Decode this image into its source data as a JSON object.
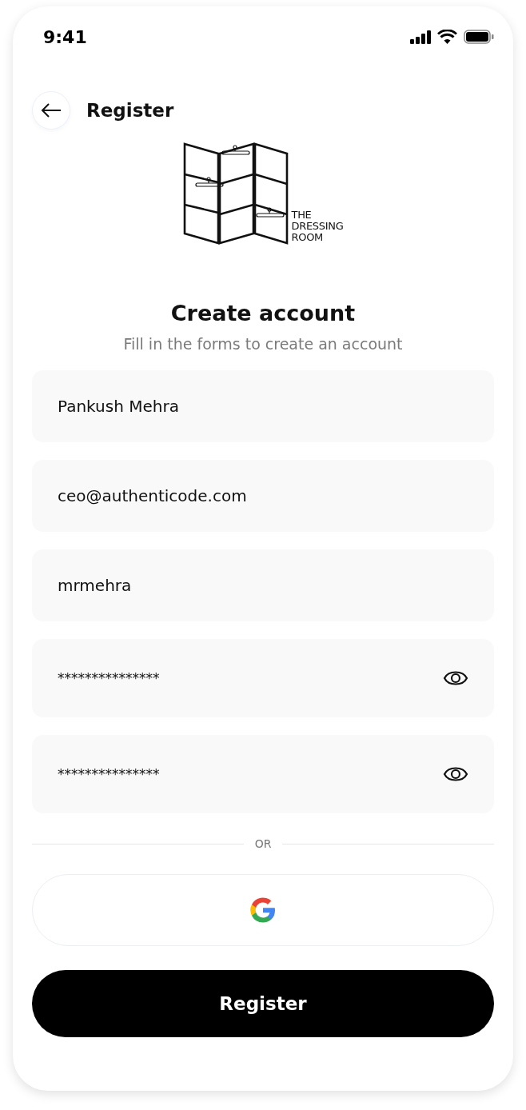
{
  "status_bar": {
    "time": "9:41"
  },
  "header": {
    "title": "Register"
  },
  "logo": {
    "lines": [
      "THE",
      "DRESSING",
      "ROOM"
    ]
  },
  "title": "Create account",
  "subtitle": "Fill in the forms to create an account",
  "fields": [
    {
      "kind": "text",
      "value": "Pankush Mehra"
    },
    {
      "kind": "text",
      "value": "ceo@authenticode.com"
    },
    {
      "kind": "text",
      "value": "mrmehra"
    },
    {
      "kind": "password",
      "value": "***************"
    },
    {
      "kind": "password",
      "value": "***************"
    }
  ],
  "divider": "OR",
  "register_button": "Register"
}
